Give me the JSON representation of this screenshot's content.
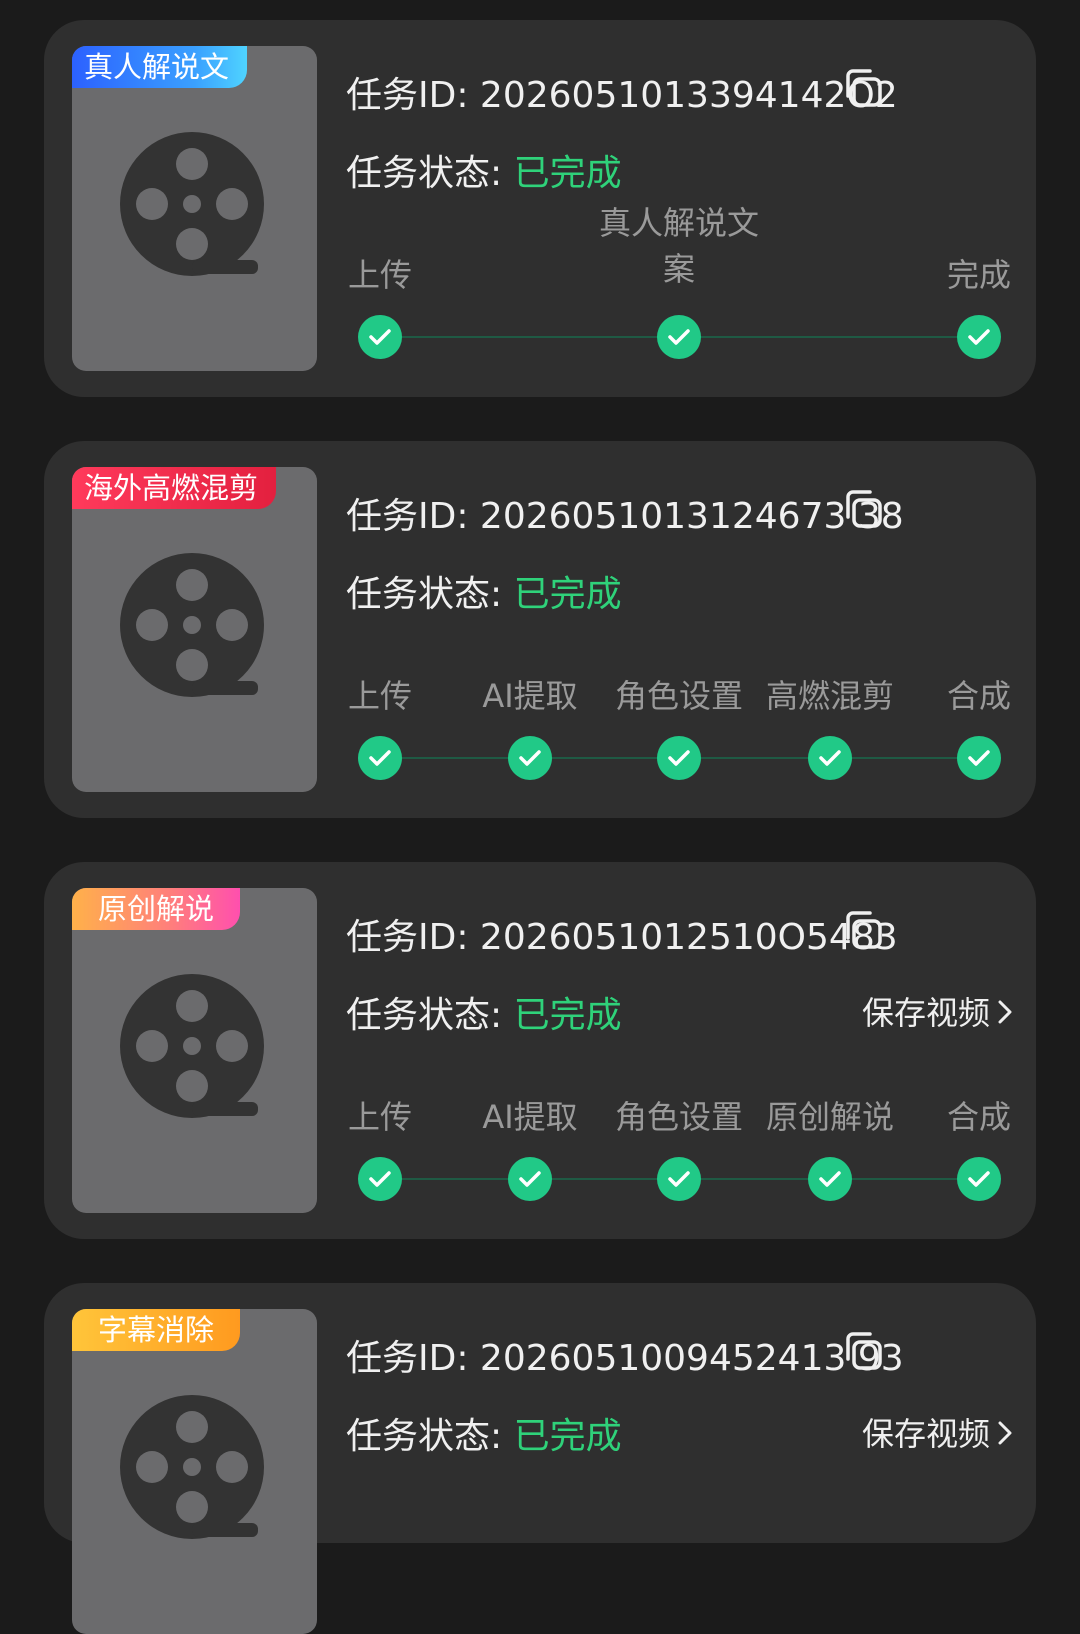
{
  "labels": {
    "task_id_prefix": "任务ID: ",
    "task_status_prefix": "任务状态: ",
    "save_video": "保存视频"
  },
  "icons": {
    "thumbnail": "film-reel-icon",
    "copy": "copy-icon",
    "step_done": "check-icon",
    "save_arrow": "chevron-right-icon"
  },
  "colors": {
    "status_done": "#2fd27a",
    "step_dot": "#21c987"
  },
  "tasks": [
    {
      "tag": "真人解说文",
      "task_id": "2026051013394142O2",
      "status": "已完成",
      "steps": [
        "上传",
        "真人解说文案",
        "完成"
      ]
    },
    {
      "tag": "海外高燃混剪",
      "task_id": "2026051013124673 38",
      "status": "已完成",
      "steps": [
        "上传",
        "AI提取",
        "角色设置",
        "高燃混剪",
        "合成"
      ]
    },
    {
      "tag": "原创解说",
      "task_id": "2026051012510O5483",
      "status": "已完成",
      "save": "保存视频",
      "steps": [
        "上传",
        "AI提取",
        "角色设置",
        "原创解说",
        "合成"
      ]
    },
    {
      "tag": "字幕消除",
      "task_id": "2026051009452413 93",
      "status": "已完成",
      "save": "保存视频",
      "steps": []
    }
  ]
}
